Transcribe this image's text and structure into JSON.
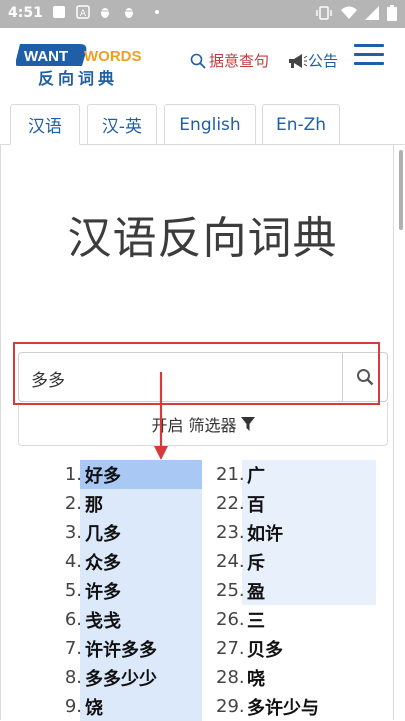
{
  "status_bar": {
    "time": "4:51",
    "icons": [
      "notification-square-icon",
      "app-a-icon",
      "bug-icon",
      "bug-icon",
      "dot-icon"
    ],
    "right_icons": [
      "vibrate-icon",
      "wifi-icon",
      "signal-icon",
      "battery-icon"
    ]
  },
  "header": {
    "logo_top_left": "WANT",
    "logo_top_right": "WORDS",
    "logo_bottom": "反向词典",
    "search_link": "据意查句",
    "notice_link": "公告"
  },
  "tabs": [
    {
      "label": "汉语",
      "active": true
    },
    {
      "label": "汉-英",
      "active": false
    },
    {
      "label": "English",
      "active": false
    },
    {
      "label": "En-Zh",
      "active": false
    }
  ],
  "title": "汉语反向词典",
  "search": {
    "value": "多多",
    "placeholder": ""
  },
  "filter": {
    "label": "开启 筛选器"
  },
  "results_left": [
    {
      "num": "1.",
      "word": "好多",
      "score": 1.0
    },
    {
      "num": "2.",
      "word": "那",
      "score": 0.9
    },
    {
      "num": "3.",
      "word": "几多",
      "score": 0.9
    },
    {
      "num": "4.",
      "word": "众多",
      "score": 0.9
    },
    {
      "num": "5.",
      "word": "许多",
      "score": 0.9
    },
    {
      "num": "6.",
      "word": "戋戋",
      "score": 0.9
    },
    {
      "num": "7.",
      "word": "许许多多",
      "score": 0.9
    },
    {
      "num": "8.",
      "word": "多多少少",
      "score": 0.9
    },
    {
      "num": "9.",
      "word": "饶",
      "score": 0.9
    }
  ],
  "results_right": [
    {
      "num": "21.",
      "word": "广",
      "score": 0.5
    },
    {
      "num": "22.",
      "word": "百",
      "score": 0.5
    },
    {
      "num": "23.",
      "word": "如许",
      "score": 0.5
    },
    {
      "num": "24.",
      "word": "斥",
      "score": 0.5
    },
    {
      "num": "25.",
      "word": "盈",
      "score": 0.5
    },
    {
      "num": "26.",
      "word": "三",
      "score": 0
    },
    {
      "num": "27.",
      "word": "贝多",
      "score": 0
    },
    {
      "num": "28.",
      "word": "哓",
      "score": 0
    },
    {
      "num": "29.",
      "word": "多许少与",
      "score": 0
    }
  ],
  "colors": {
    "accent_blue": "#1f5fa8",
    "search_red": "#c23b3b",
    "highlight_red": "#d63a3a",
    "strong_bar": "#a9c8f4",
    "light_bar": "#dce9fb",
    "pale_bar": "#e8f0fc"
  }
}
